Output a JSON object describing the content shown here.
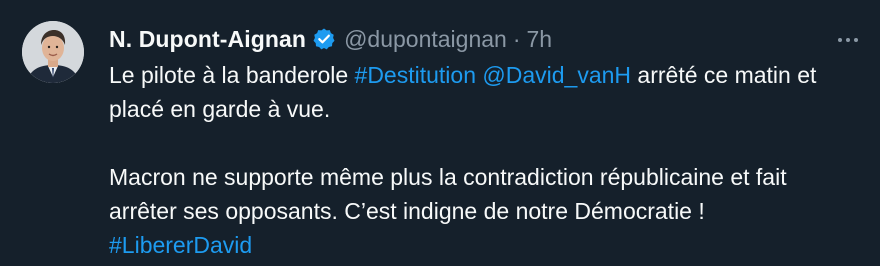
{
  "author": {
    "name": "N. Dupont-Aignan",
    "handle": "@dupontaignan",
    "separator": "·",
    "time": "7h"
  },
  "tweet": {
    "para1": {
      "t1": "Le pilote à la banderole ",
      "hashtag1": "#Destitution",
      "space1": " ",
      "mention1": "@David_vanH",
      "t2": " arrêté ce matin et placé en garde à vue."
    },
    "para2": {
      "line1": "Macron ne supporte même plus la contradiction républicaine et fait arrêter ses opposants. C’est indigne de notre Démocratie !",
      "hashtag2": "#LibererDavid"
    }
  },
  "colors": {
    "background": "#15202b",
    "text": "#f7f9f9",
    "muted": "#8b98a5",
    "link": "#1d9bf0"
  },
  "icons": {
    "verified": "verified-badge-icon",
    "more": "more-options-icon"
  }
}
